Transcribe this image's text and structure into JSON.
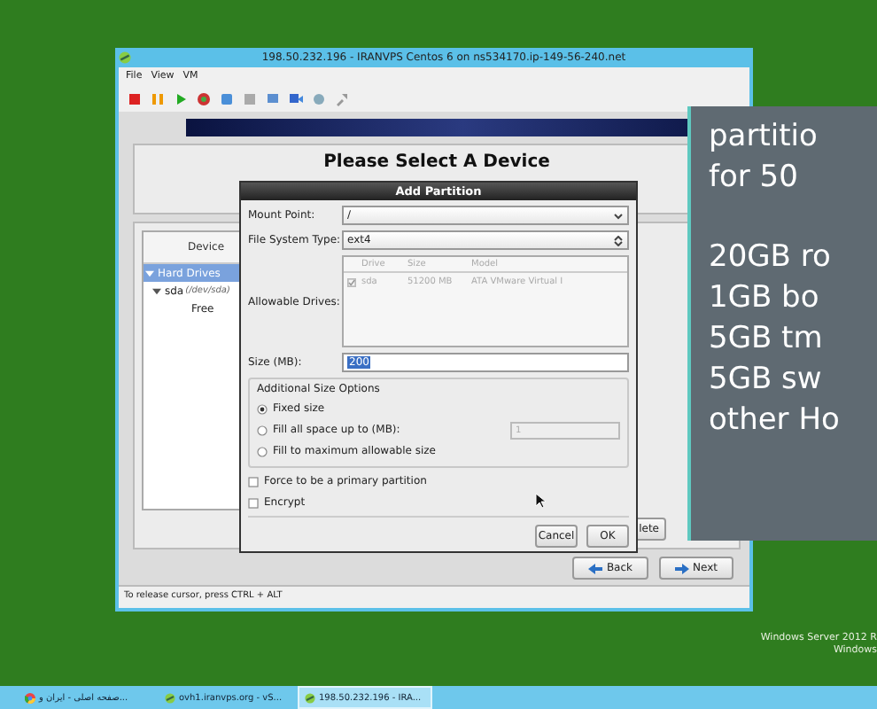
{
  "vm_window": {
    "title": "198.50.232.196 - IRANVPS Centos 6 on ns534170.ip-149-56-240.net",
    "menu": [
      "File",
      "View",
      "VM"
    ],
    "status_bar": "To release cursor, press CTRL + ALT"
  },
  "installer": {
    "heading": "Please Select A Device",
    "device_column": "Device",
    "tree": [
      {
        "label": "Hard Drives",
        "selected": true,
        "expanded": true,
        "children": [
          {
            "label": "sda",
            "detail": "(/dev/sda)",
            "selected": false,
            "expanded": true,
            "children": [
              {
                "label": "Free",
                "selected": false
              }
            ]
          }
        ]
      }
    ],
    "partial_button": "lete",
    "buttons": [
      {
        "label": "Back",
        "kind": "back"
      },
      {
        "label": "Next",
        "kind": "next"
      }
    ]
  },
  "dialog": {
    "title": "Add Partition",
    "mount_point": {
      "label": "Mount Point:",
      "value": "/"
    },
    "fs_type": {
      "label": "File System Type:",
      "value": "ext4"
    },
    "drives": {
      "label": "Allowable Drives:",
      "disabled": true,
      "columns": [
        "Drive",
        "Size",
        "Model"
      ],
      "rows": [
        {
          "checked": true,
          "cells": [
            "sda",
            "51200 MB",
            "ATA VMware Virtual I"
          ]
        }
      ]
    },
    "size": {
      "label": "Size (MB):",
      "value": "200"
    },
    "size_options": {
      "title": "Additional Size Options",
      "options": [
        {
          "label": "Fixed size",
          "selected": true
        },
        {
          "label": "Fill all space up to (MB):",
          "selected": false,
          "spin_value": "1",
          "spin_disabled": true
        },
        {
          "label": "Fill to maximum allowable size",
          "selected": false
        }
      ]
    },
    "checkboxes": [
      {
        "label": "Force to be a primary partition",
        "checked": false
      },
      {
        "label": "Encrypt",
        "checked": false
      }
    ],
    "buttons": [
      "Cancel",
      "OK"
    ]
  },
  "overlay": {
    "groups": [
      [
        "partitio",
        "for 50"
      ],
      [
        "20GB ro",
        "1GB bo",
        "5GB tm",
        "5GB sw",
        "other Ho"
      ]
    ]
  },
  "desktop": {
    "lines": [
      "Windows Server 2012 R",
      "Windows"
    ]
  },
  "taskbar": {
    "items": [
      {
        "label": "صفحه اصلی - ایران و...",
        "kind": "browser",
        "selected": false
      },
      {
        "label": "ovh1.iranvps.org - vS...",
        "kind": "vm",
        "selected": false
      },
      {
        "label": "198.50.232.196 - IRA...",
        "kind": "vm",
        "selected": true
      }
    ]
  }
}
